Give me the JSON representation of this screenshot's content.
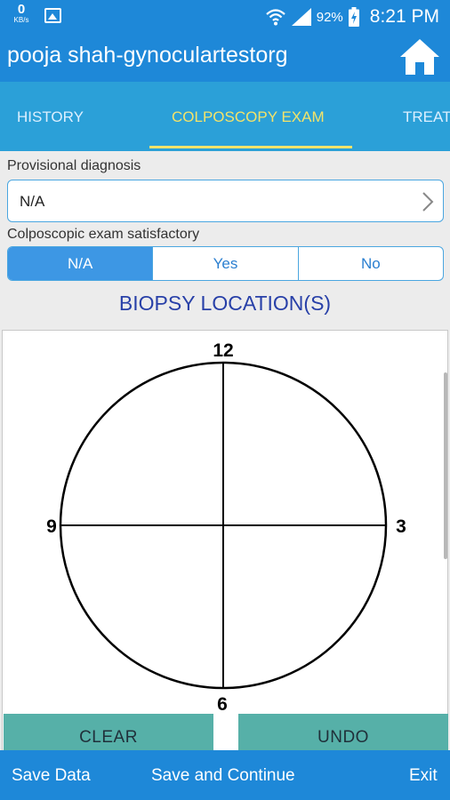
{
  "status_bar": {
    "net_speed": "0",
    "net_unit": "KB/s",
    "battery": "92%",
    "time": "8:21 PM"
  },
  "app_bar": {
    "title": "pooja shah-gynoculartestorg"
  },
  "tabs": [
    {
      "label": "HISTORY",
      "active": false
    },
    {
      "label": "COLPOSCOPY EXAM",
      "active": true
    },
    {
      "label": "TREAT",
      "active": false
    }
  ],
  "form": {
    "provisional_diagnosis_label": "Provisional diagnosis",
    "provisional_diagnosis_value": "N/A",
    "satisfactory_label": "Colposcopic exam satisfactory",
    "satisfactory_options": [
      {
        "label": "N/A",
        "selected": true
      },
      {
        "label": "Yes",
        "selected": false
      },
      {
        "label": "No",
        "selected": false
      }
    ]
  },
  "biopsy": {
    "title": "BIOPSY LOCATION(S)",
    "clock_labels": {
      "top": "12",
      "right": "3",
      "bottom": "6",
      "left": "9"
    },
    "clear_label": "CLEAR",
    "undo_label": "UNDO"
  },
  "bottom_bar": {
    "save_data": "Save Data",
    "save_continue": "Save and Continue",
    "exit": "Exit"
  },
  "colors": {
    "primary": "#1e88d8",
    "tab_bar": "#2ba0d8",
    "tab_active": "#f3e36a",
    "segment_selected": "#3d97e4",
    "section_title": "#2840a8",
    "action_button": "#56b0a8"
  }
}
